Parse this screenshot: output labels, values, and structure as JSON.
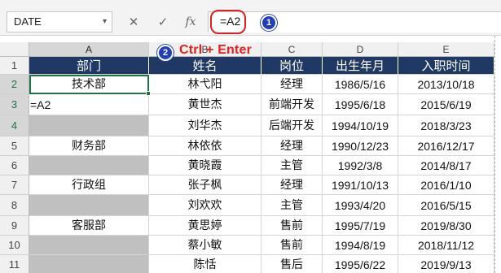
{
  "formula_bar": {
    "name_box": "DATE",
    "name_box_arrow": "▾",
    "cancel_symbol": "✕",
    "enter_symbol": "✓",
    "fx_label": "fx",
    "formula": "=A2"
  },
  "annotation": {
    "step1": "1",
    "step2": "2",
    "shortcut": "Ctrl + Enter"
  },
  "columns": [
    "A",
    "B",
    "C",
    "D",
    "E"
  ],
  "rows": [
    "1",
    "2",
    "3",
    "4",
    "5",
    "6",
    "7",
    "8",
    "9",
    "10",
    "11"
  ],
  "headers": [
    "部门",
    "姓名",
    "岗位",
    "出生年月",
    "入职时间"
  ],
  "table": [
    {
      "a": "技术部",
      "b": "林弋阳",
      "c": "经理",
      "d": "1986/5/16",
      "e": "2013/10/18"
    },
    {
      "a": "=A2",
      "b": "黄世杰",
      "c": "前端开发",
      "d": "1995/6/18",
      "e": "2015/6/19"
    },
    {
      "a": "",
      "b": "刘华杰",
      "c": "后端开发",
      "d": "1994/10/19",
      "e": "2018/3/23"
    },
    {
      "a": "财务部",
      "b": "林依依",
      "c": "经理",
      "d": "1990/12/23",
      "e": "2016/12/17"
    },
    {
      "a": "",
      "b": "黄晓霞",
      "c": "主管",
      "d": "1992/3/8",
      "e": "2014/8/17"
    },
    {
      "a": "行政组",
      "b": "张子枫",
      "c": "经理",
      "d": "1991/10/13",
      "e": "2016/1/10"
    },
    {
      "a": "",
      "b": "刘欢欢",
      "c": "主管",
      "d": "1993/4/20",
      "e": "2016/5/15"
    },
    {
      "a": "客服部",
      "b": "黄思婷",
      "c": "售前",
      "d": "1995/7/19",
      "e": "2019/8/30"
    },
    {
      "a": "",
      "b": "蔡小敏",
      "c": "售前",
      "d": "1994/8/19",
      "e": "2018/11/12"
    },
    {
      "a": "",
      "b": "陈恬",
      "c": "售后",
      "d": "1995/6/22",
      "e": "2019/9/13"
    }
  ],
  "colors": {
    "header_bg": "#203864",
    "blank_fill": "#c0c0c0",
    "selection": "#217346",
    "annotation": "#e81c1c",
    "badge": "#1f3fbf"
  }
}
